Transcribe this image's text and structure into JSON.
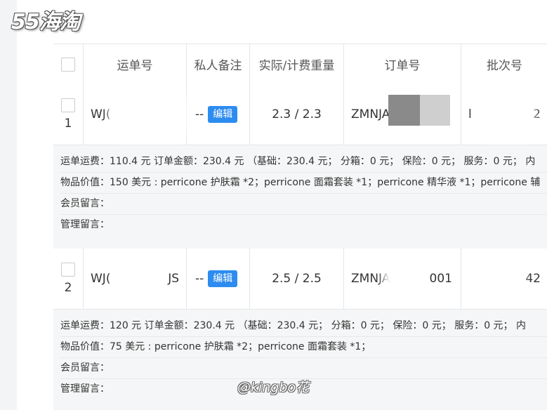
{
  "watermark": {
    "logo": "55海淘",
    "signature": "@kingbo花"
  },
  "table": {
    "headers": [
      "运单号",
      "私人备注",
      "实际/计费重量",
      "订单号",
      "批次号"
    ],
    "rows": [
      {
        "index": "1",
        "waybill": "WJ(",
        "note": "--",
        "edit_label": "编辑",
        "weight": "2.3 / 2.3",
        "order_no": "ZMNJA",
        "batch_prefix": "l",
        "batch_suffix": "2",
        "fee_line": "运单运费：110.4 元 订单金额：230.4 元 （基础：230.4 元； 分箱：0 元； 保险：0 元； 服务：0 元； 内",
        "goods_line": "物品价值：150 美元 : perricone 护肤霜 *2；perricone 面霜套装 *1；perricone 精华液 *1；perricone 辅",
        "member_msg_label": "会员留言：",
        "admin_msg_label": "管理留言："
      },
      {
        "index": "2",
        "waybill": "WJ(",
        "waybill_suffix": "JS",
        "note": "--",
        "edit_label": "编辑",
        "weight": "2.5 / 2.5",
        "order_no": "ZMNJA",
        "order_suffix": "001",
        "batch_suffix": "42",
        "fee_line": "运单运费：120 元 订单金额：230.4 元 （基础：230.4 元； 分箱：0 元； 保险：0 元； 服务：0 元； 内",
        "goods_line": "物品价值：75 美元 : perricone 护肤霜 *2；perricone 面霜套装 *1；",
        "member_msg_label": "会员留言：",
        "admin_msg_label": "管理留言："
      }
    ]
  }
}
